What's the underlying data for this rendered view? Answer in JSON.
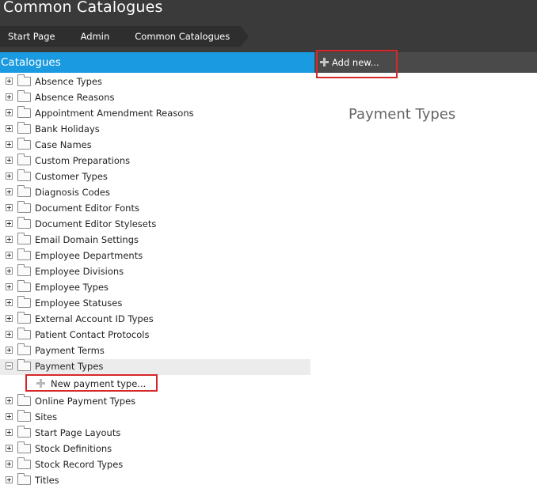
{
  "header": {
    "title": "Common Catalogues",
    "breadcrumb": [
      "Start Page",
      "Admin",
      "Common Catalogues"
    ]
  },
  "catalogues": {
    "title": "Catalogues",
    "items_before": [
      "Absence Types",
      "Absence Reasons",
      "Appointment Amendment Reasons",
      "Bank Holidays",
      "Case Names",
      "Custom Preparations",
      "Customer Types",
      "Diagnosis Codes",
      "Document Editor Fonts",
      "Document Editor Stylesets",
      "Email Domain Settings",
      "Employee Departments",
      "Employee Divisions",
      "Employee Types",
      "Employee Statuses",
      "External Account ID Types",
      "Patient Contact Protocols",
      "Payment Terms"
    ],
    "selected": {
      "label": "Payment Types",
      "child_action": "New payment type..."
    },
    "items_after": [
      "Online Payment Types",
      "Sites",
      "Start Page Layouts",
      "Stock Definitions",
      "Stock Record Types",
      "Titles"
    ]
  },
  "toolbar": {
    "add_new_label": "Add new..."
  },
  "detail": {
    "title": "Payment Types"
  },
  "colors": {
    "header_bg": "#3a3a3a",
    "catalogues_header_bg": "#1a9ae0",
    "toolbar_bg": "#4a4a4a",
    "highlight": "#d62828",
    "selected_row_bg": "#ececec"
  }
}
